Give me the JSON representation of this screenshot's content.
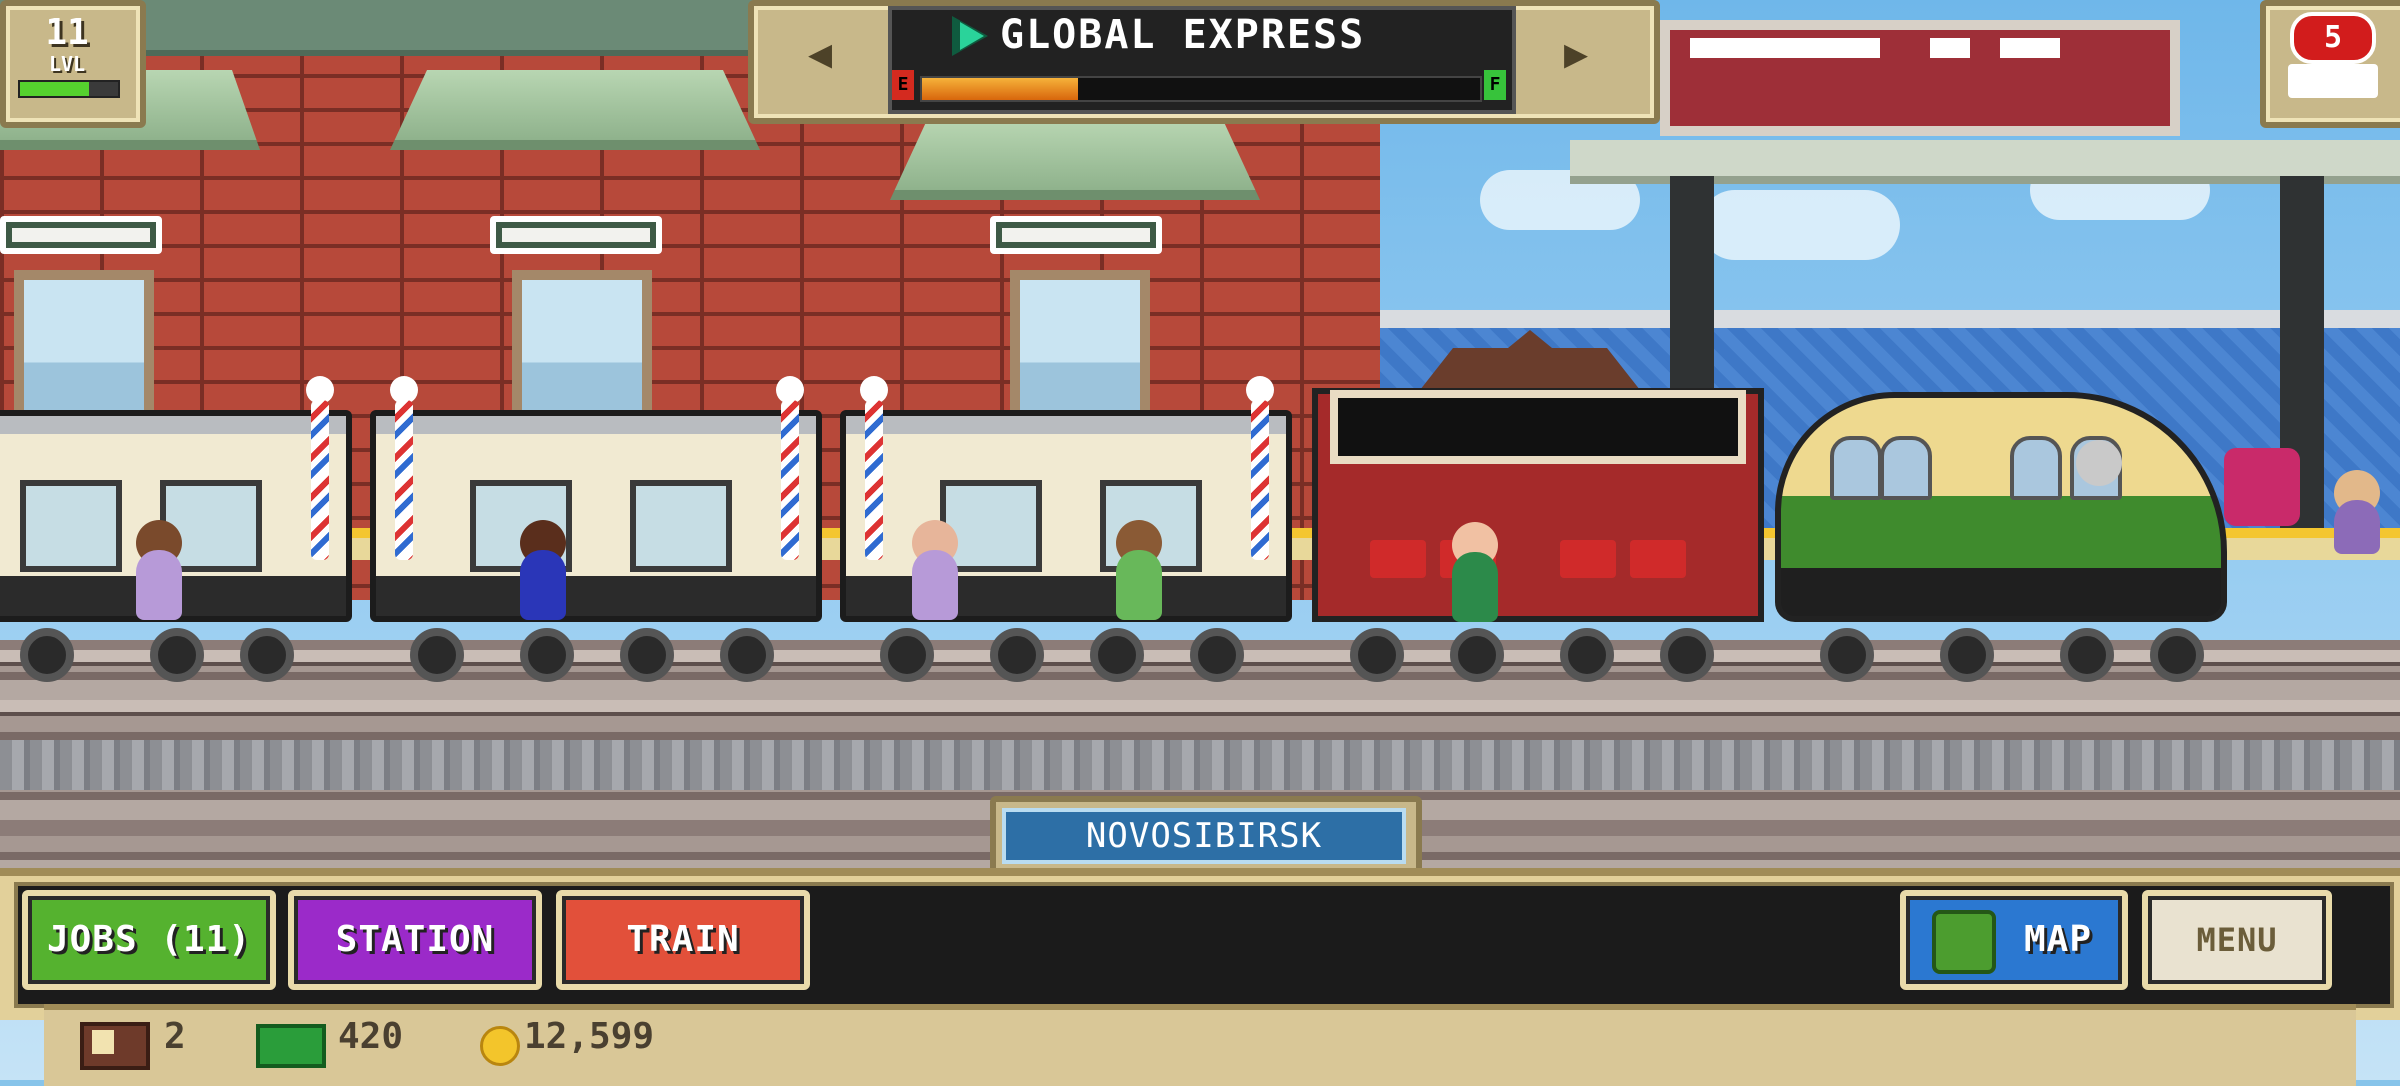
{
  "hud": {
    "level": {
      "number": "11",
      "label": "LVL",
      "progress": 0.7
    },
    "train_name": "GLOBAL EXPRESS",
    "fuel": {
      "empty_label": "E",
      "full_label": "F",
      "level": 0.28,
      "color": "#e07a14"
    },
    "prev_train_icon": "arrow-left",
    "next_train_icon": "arrow-right",
    "train_count_badge": "5"
  },
  "station_name": "NOVOSIBIRSK",
  "bottom_buttons": {
    "jobs": "JOBS (11)",
    "station": "STATION",
    "train": "TRAIN",
    "map": "MAP",
    "menu": "MENU"
  },
  "resources": {
    "tickets": "2",
    "cash": "420",
    "coins": "12,599"
  },
  "colors": {
    "jobs_button": "#55b22f",
    "station_button": "#9b2ac9",
    "train_button": "#e2503a",
    "map_button": "#2b78d1",
    "badge": "#d21c1c"
  }
}
